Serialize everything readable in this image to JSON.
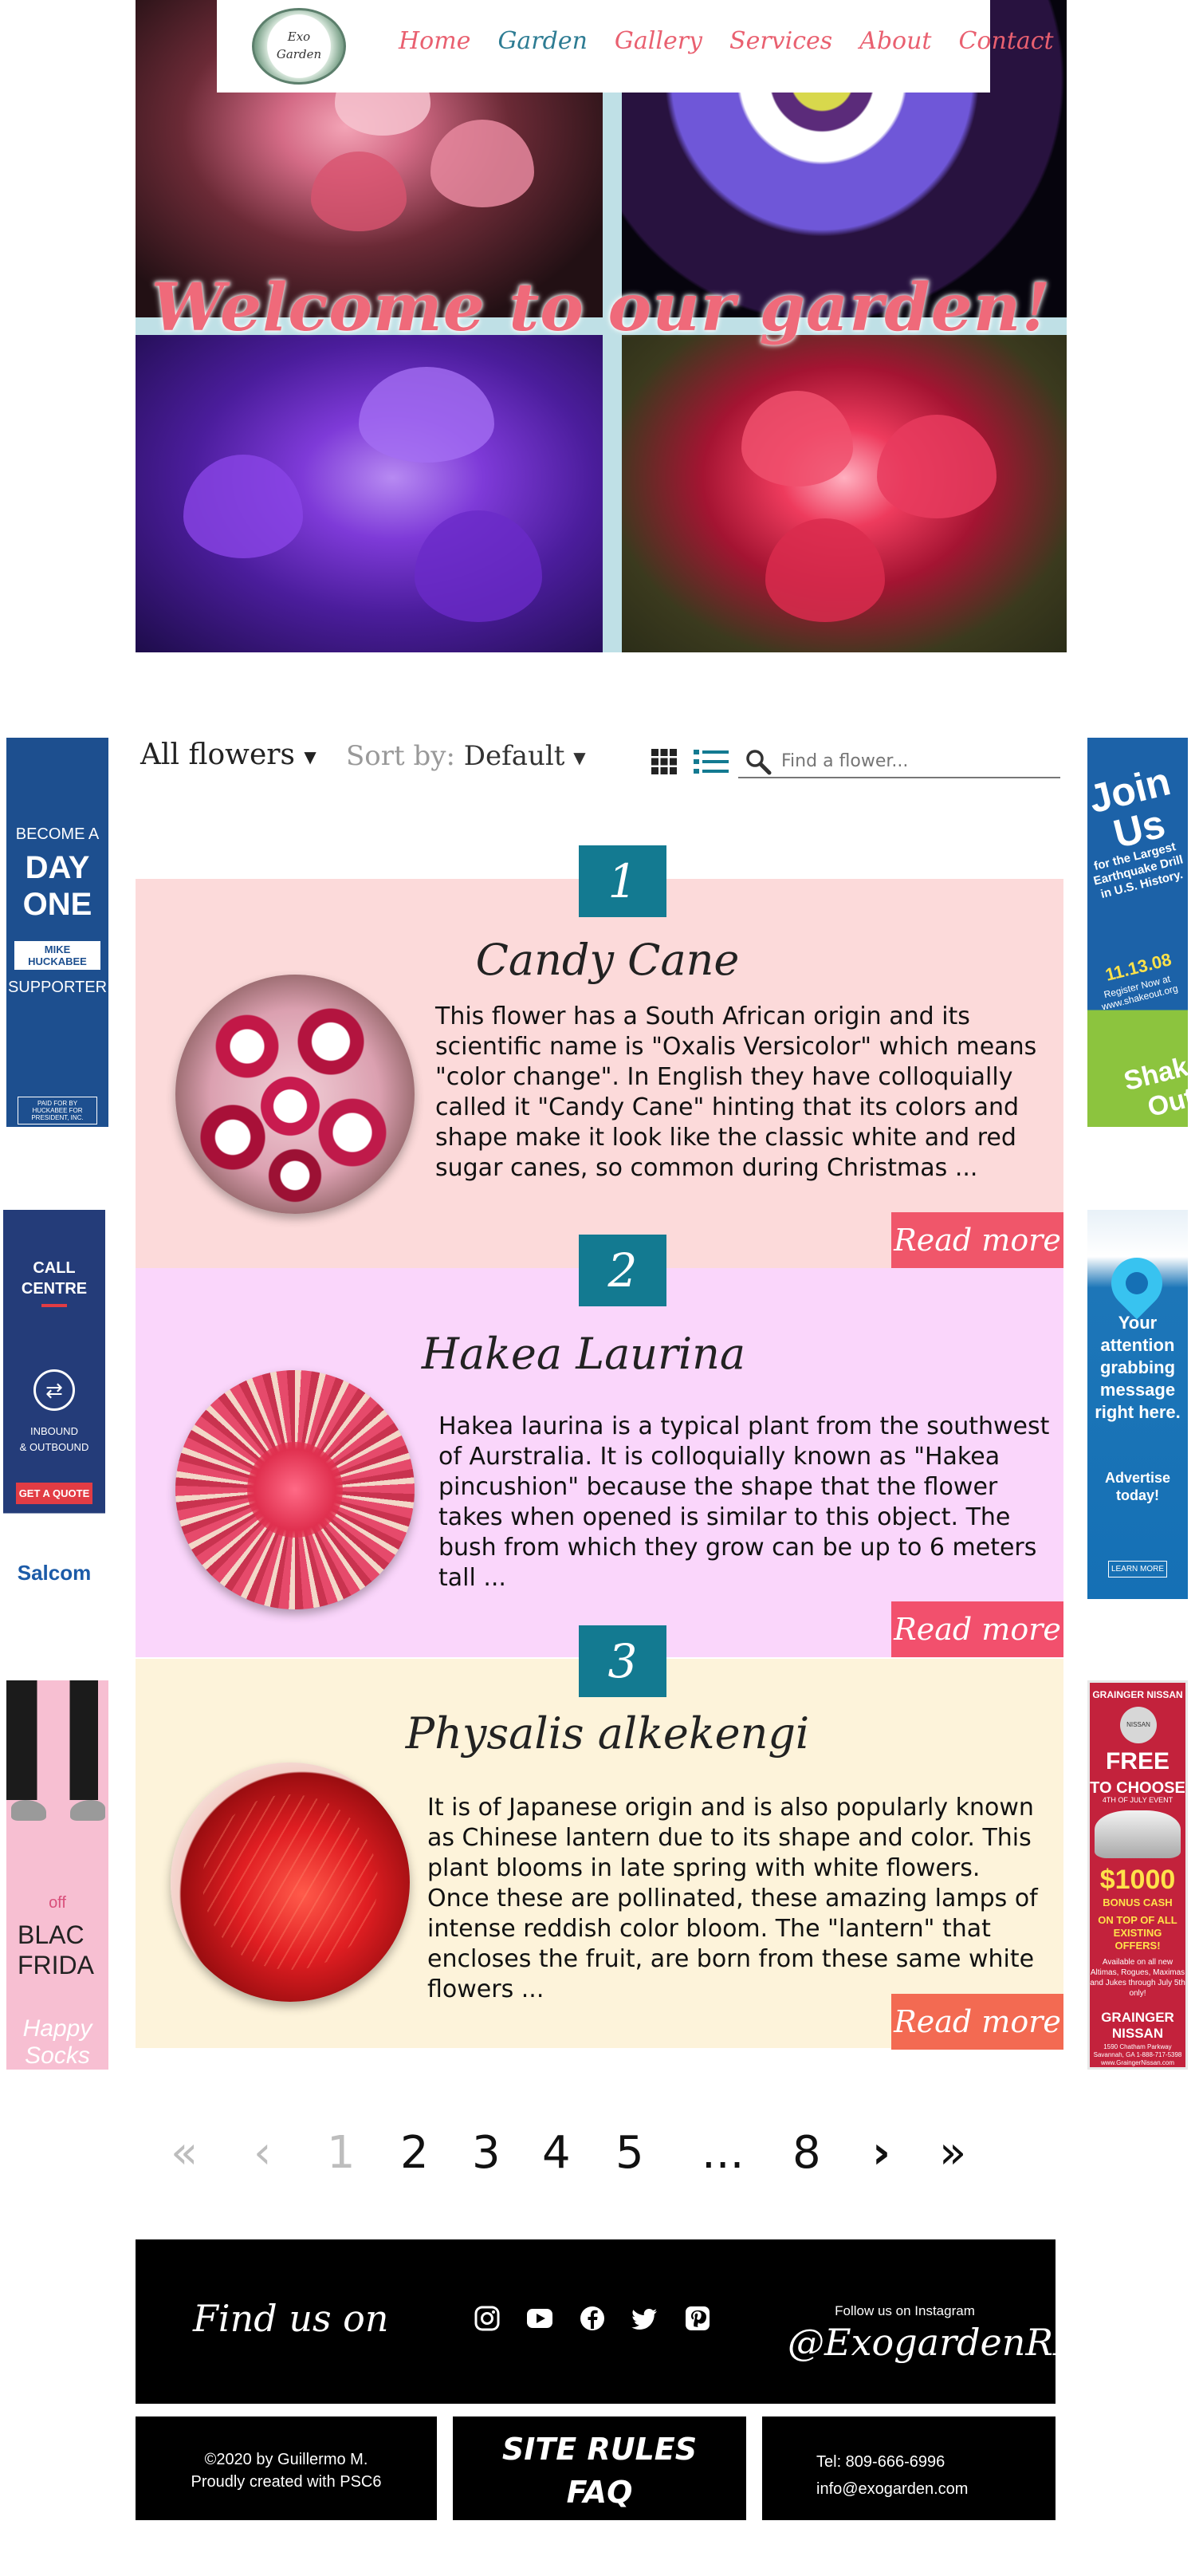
{
  "hero": {
    "title": "Welcome to our garden!"
  },
  "nav": {
    "logo_line1": "Exo",
    "logo_line2": "Garden",
    "links": [
      "Home",
      "Garden",
      "Gallery",
      "Services",
      "About",
      "Contact"
    ],
    "active": "Garden"
  },
  "toolbar": {
    "filter_label": "All flowers",
    "sort_prefix": "Sort by:",
    "sort_value": "Default",
    "search_placeholder": "Find a flower..."
  },
  "cards": [
    {
      "number": "1",
      "title": "Candy Cane",
      "text": "This flower has a South African origin and its scientific name is \"Oxalis Versicolor\" which means \"color change\". In English they have colloquially called it \"Candy Cane\" hinting that its colors and shape make it look like the classic white and red sugar canes, so common during Christmas ...",
      "read_more": "Read more",
      "bg_color": "#fcdada",
      "button_color": "#f0566a"
    },
    {
      "number": "2",
      "title": "Hakea Laurina",
      "text": "Hakea laurina is a typical plant from the southwest of Aurstralia. It is colloquially known as \"Hakea pincushion\" because the shape that the flower takes when opened is similar to this object. The bush from which they grow can be up to 6 meters tall ...",
      "read_more": "Read more",
      "bg_color": "#fad6fb",
      "button_color": "#f2506d"
    },
    {
      "number": "3",
      "title": "Physalis alkekengi",
      "text": "It is of Japanese origin and is also popularly known as Chinese lantern due to its shape and color. This plant blooms in late spring with white flowers. Once these are pollinated, these amazing lamps of intense reddish color bloom. The \"lantern\" that encloses the fruit, are born from these same white flowers ...",
      "read_more": "Read more",
      "bg_color": "#fdf3da",
      "button_color": "#f36a52"
    }
  ],
  "pagination": {
    "first": "«",
    "prev": "‹",
    "pages": [
      "1",
      "2",
      "3",
      "4",
      "5"
    ],
    "ellipsis": "...",
    "last_page": "8",
    "next": "›",
    "last": "»",
    "current": "1"
  },
  "footer": {
    "find_us": "Find us on",
    "social_icons": [
      "instagram-icon",
      "youtube-icon",
      "facebook-icon",
      "twitter-icon",
      "pinterest-icon"
    ],
    "follow_label": "Follow us on Instagram",
    "handle": "@ExogardenRD",
    "copyright_line1": "©2020 by Guillermo M.",
    "copyright_line2": "Proudly created with PSC6",
    "site_rules": "SITE RULES",
    "faq": "FAQ",
    "tel": "Tel: 809-666-6996",
    "email": "info@exogarden.com"
  },
  "ads": {
    "left_1": {
      "line1": "BECOME A",
      "line2": "DAY",
      "line3": "ONE",
      "brand": "MIKE HUCKABEE",
      "line4": "SUPPORTER",
      "fine_print": "PAID FOR BY HUCKABEE FOR PRESIDENT, INC."
    },
    "left_2": {
      "line1": "CALL",
      "line2": "CENTRE",
      "line3": "INBOUND",
      "line4": "& OUTBOUND",
      "cta": "GET A QUOTE",
      "brand": "Salcom"
    },
    "left_3": {
      "line1": "off",
      "line2": "BLAC",
      "line3": "FRIDA",
      "brand": "Happy Socks"
    },
    "right_1": {
      "line1": "Join",
      "line2": "Us",
      "line3": "for the Largest Earthquake Drill in U.S. History.",
      "date": "11.13.08",
      "line4": "Register Now at www.shakeout.org",
      "brand": "Shake Out"
    },
    "right_2": {
      "line1": "Your attention grabbing message right here.",
      "line2": "Advertise today!",
      "cta": "LEARN MORE"
    },
    "right_3": {
      "dealer": "GRAINGER NISSAN",
      "badge": "NISSAN",
      "line1": "FREE",
      "line2": "TO CHOOSE",
      "line3": "4TH OF JULY EVENT",
      "amount": "$1000",
      "line4": "BONUS CASH",
      "line5": "ON TOP OF ALL EXISTING OFFERS!",
      "line6": "Available on all new Altimas, Rogues, Maximas and Jukes through July 5th only!",
      "dealer2": "GRAINGER NISSAN",
      "address": "1590 Chatham Parkway Savannah, GA 1-888-717-5398 www.GraingerNissan.com"
    }
  }
}
